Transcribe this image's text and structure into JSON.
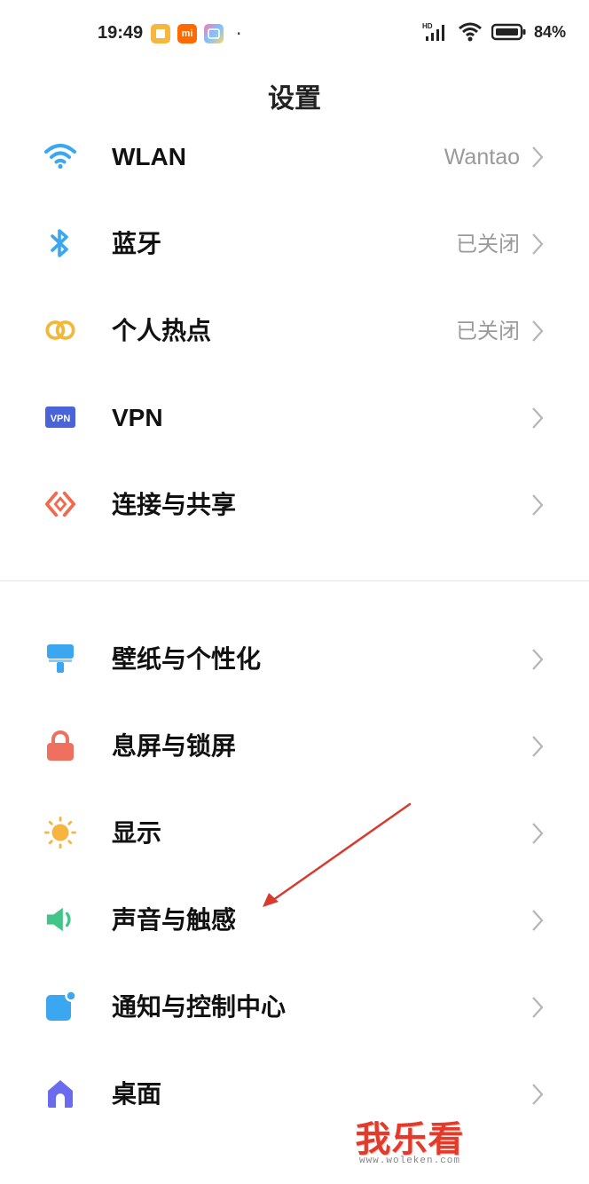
{
  "status_bar": {
    "time": "19:49",
    "mi_label": "mi",
    "overflow_dot": "·",
    "network_label": "HD",
    "battery_percent": "84%"
  },
  "header": {
    "title": "设置"
  },
  "sections": [
    {
      "items": [
        {
          "label": "WLAN",
          "value": "Wantao",
          "icon": "wifi-icon",
          "color": "#3aa7f0"
        },
        {
          "label": "蓝牙",
          "value": "已关闭",
          "icon": "bluetooth-icon",
          "color": "#3aa7f0"
        },
        {
          "label": "个人热点",
          "value": "已关闭",
          "icon": "hotspot-icon",
          "color": "#f2b83a"
        },
        {
          "label": "VPN",
          "value": "",
          "icon": "vpn-icon",
          "icon_text": "VPN",
          "color": "#4b63d9"
        },
        {
          "label": "连接与共享",
          "value": "",
          "icon": "connection-share-icon",
          "color": "#f06a4f"
        }
      ]
    },
    {
      "items": [
        {
          "label": "壁纸与个性化",
          "value": "",
          "icon": "wallpaper-icon",
          "color": "#3aa7f0"
        },
        {
          "label": "息屏与锁屏",
          "value": "",
          "icon": "lock-icon",
          "color": "#f07060"
        },
        {
          "label": "显示",
          "value": "",
          "icon": "brightness-icon",
          "color": "#f6b540"
        },
        {
          "label": "声音与触感",
          "value": "",
          "icon": "speaker-icon",
          "color": "#43c58a"
        },
        {
          "label": "通知与控制中心",
          "value": "",
          "icon": "notification-icon",
          "color": "#3aa7f0"
        },
        {
          "label": "桌面",
          "value": "",
          "icon": "home-icon",
          "color": "#6b6bf0"
        }
      ]
    }
  ],
  "annotation": {
    "arrow_color": "#d83a2f",
    "target": "声音与触感"
  },
  "watermark": {
    "main": "我乐看",
    "sub": "www.woleken.com"
  }
}
